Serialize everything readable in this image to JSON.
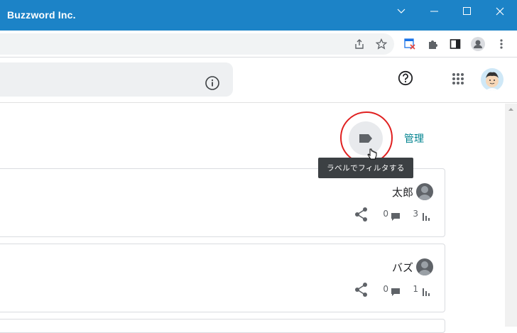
{
  "window": {
    "title": "Buzzword Inc."
  },
  "toolbar_right": {
    "manage_label": "管理",
    "tooltip": "ラベルでフィルタする"
  },
  "posts": [
    {
      "author": "太郎",
      "comments": "0",
      "views": "3"
    },
    {
      "author": "バズ",
      "comments": "0",
      "views": "1"
    }
  ],
  "colors": {
    "titlebar": "#1c83c7",
    "accent": "#00838f",
    "annotation": "#e02020"
  }
}
